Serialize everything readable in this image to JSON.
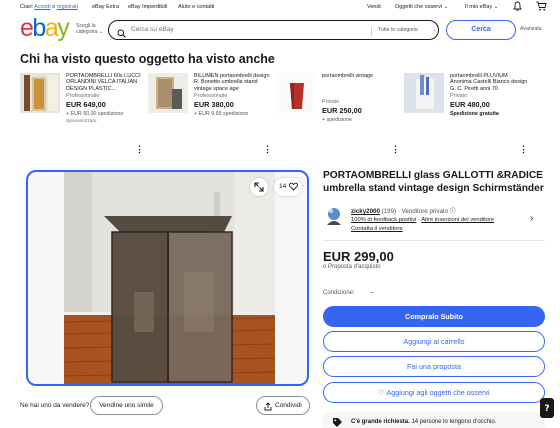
{
  "topbar": {
    "greeting": "Ciao!",
    "login": "Accedi",
    "or": "o",
    "register": "registrati",
    "deals": "eBay Extra",
    "unmissable": "eBay Imperdibili",
    "help": "Aiuto e contatti",
    "sell": "Vendi",
    "watchlist": "Oggetti che osservi",
    "my_ebay": "Il mio eBay"
  },
  "header": {
    "logo_letters": [
      "e",
      "b",
      "a",
      "y"
    ],
    "logo_colors": [
      "#e53238",
      "#0064d2",
      "#f5af02",
      "#86b817"
    ],
    "shop_by_line1": "Scegli la",
    "shop_by_line2": "categoria",
    "search_placeholder": "Cerca su eBay",
    "category_select": "Tutte le categorie",
    "search_button": "Cerca",
    "advanced": "Avanzata"
  },
  "recently_viewed": {
    "title": "Chi ha visto questo oggetto ha visto anche",
    "items": [
      {
        "name": "PORTAOMBRELLI 60s LUCCI ORLANDINI VELCA ITALIAN DESIGN PLASTIC...",
        "condition": "Professionale",
        "price": "EUR 649,00",
        "shipping": "+ EUR 50,00 spedizione",
        "sponsored": "Sponsorizzato"
      },
      {
        "name": "BILUMEN portaombrelli design R. Bonetto umbrella stand vintage space age",
        "condition": "Professionale",
        "price": "EUR 380,00",
        "shipping": "+ EUR 9,99 spedizione",
        "sponsored": ""
      },
      {
        "name": "portaombrelli vintage",
        "condition": "Privato",
        "price": "EUR 250,00",
        "shipping": "+ spedizione",
        "sponsored": ""
      },
      {
        "name": "portaombrelli PLUVIUM Anonima Castelli Bianco design G. C. Piretti anni 70",
        "condition": "Privato",
        "price": "EUR 480,00",
        "shipping": "Spedizione gratuita",
        "sponsored": ""
      }
    ]
  },
  "gallery": {
    "watch_count": "14"
  },
  "bottom_left": {
    "question": "Ne hai uno da vendere?",
    "sell_similar": "Vendine uno simile",
    "share": "Condividi"
  },
  "listing": {
    "title": "PORTAOMBRELLI glass GALLOTTI &RADICE umbrella stand vintage design Schirmständer",
    "seller_name": "zicky2000",
    "seller_count": "(199)",
    "seller_type": "· Venditore privato",
    "feedback": "100% di feedback positivi",
    "other_items": "Altre inserzioni del venditore",
    "contact": "Contatta il venditore",
    "price": "EUR 299,00",
    "or_offer": "o Proposta d'acquisto",
    "condition_label": "Condizione:",
    "condition_value": "--",
    "buy_now": "Compralo Subito",
    "add_to_cart": "Aggiungi al carrello",
    "make_offer": "Fai una proposta",
    "add_watch": "Aggiungi agli oggetti che osservi",
    "alert_bold": "C'è grande richiesta.",
    "alert_text": "14 persone lo tengono d'occhio."
  }
}
